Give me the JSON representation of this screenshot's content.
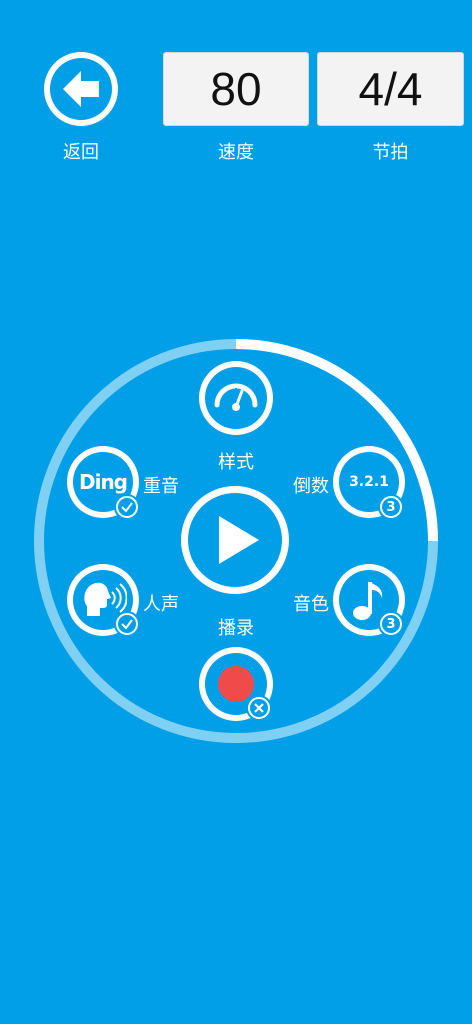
{
  "header": {
    "back_label": "返回",
    "tempo_value": "80",
    "tempo_label": "速度",
    "beat_value": "4/4",
    "beat_label": "节拍"
  },
  "dial": {
    "progress": 0.25
  },
  "options": {
    "style_label": "样式",
    "accent_label": "重音",
    "accent_icon_text": "Ding",
    "countdown_label": "倒数",
    "countdown_icon_text": "3.2.1",
    "countdown_badge": "3",
    "voice_label": "人声",
    "tone_label": "音色",
    "tone_badge": "3",
    "record_label": "播录"
  },
  "colors": {
    "background": "#009fe8",
    "ring_track": "#80d0f4",
    "ring_progress": "#ffffff",
    "record_dot": "#f04a4a"
  }
}
